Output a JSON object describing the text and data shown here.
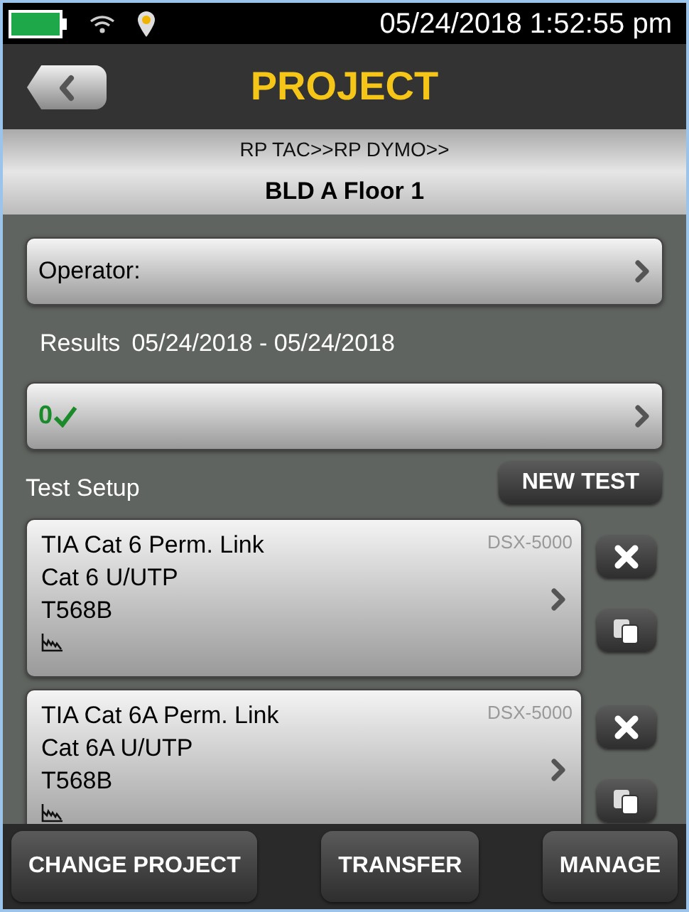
{
  "status_bar": {
    "datetime": "05/24/2018 1:52:55 pm"
  },
  "header": {
    "title": "PROJECT"
  },
  "breadcrumb": {
    "path": "RP TAC>>RP DYMO>>",
    "location": "BLD A Floor 1"
  },
  "operator": {
    "label": "Operator:"
  },
  "results": {
    "label": "Results",
    "range": "05/24/2018 - 05/24/2018",
    "pass_count": "0"
  },
  "test_setup": {
    "label": "Test Setup",
    "new_test": "NEW TEST",
    "items": [
      {
        "limit": "TIA Cat 6 Perm. Link",
        "cable": "Cat 6 U/UTP",
        "wiring": "T568B",
        "device": "DSX-5000"
      },
      {
        "limit": "TIA Cat 6A Perm. Link",
        "cable": "Cat 6A U/UTP",
        "wiring": "T568B",
        "device": "DSX-5000"
      }
    ]
  },
  "footer": {
    "buttons": [
      "CHANGE PROJECT",
      "TRANSFER",
      "MANAGE"
    ]
  }
}
